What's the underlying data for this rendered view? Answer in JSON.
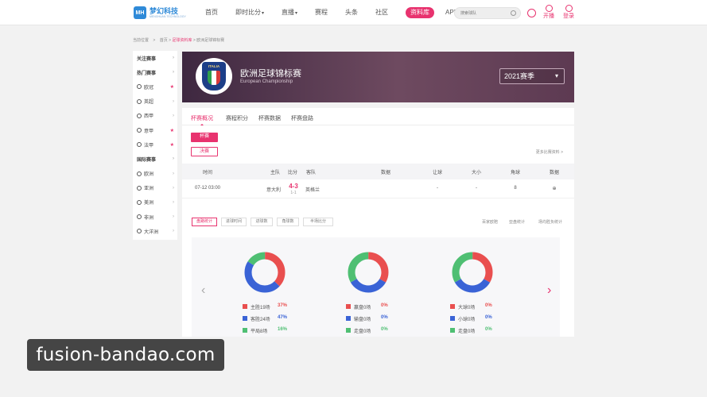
{
  "header": {
    "logo_mark": "MH",
    "logo_name": "梦幻科技",
    "logo_sub": "MENGHUAN TECHNOLOGY",
    "nav": [
      "首页",
      "即时比分",
      "直播",
      "赛程",
      "头条",
      "社区",
      "资料库",
      "APP下载"
    ],
    "search_placeholder": "搜索球队",
    "open_label": "开播",
    "login_label": "登录"
  },
  "breadcrumb": {
    "prefix": "当前位置",
    "home": "首页",
    "db": "足球资料库",
    "current": "欧洲足球锦标赛"
  },
  "sidebar": [
    {
      "label": "关注赛事",
      "type": "header"
    },
    {
      "label": "热门赛事",
      "type": "header"
    },
    {
      "label": "欧冠",
      "type": "fav",
      "icon": "ball-icon"
    },
    {
      "label": "英超",
      "type": "plain",
      "icon": "lion-icon"
    },
    {
      "label": "西甲",
      "type": "plain",
      "icon": "a-icon"
    },
    {
      "label": "意甲",
      "type": "fav",
      "icon": "ball-icon"
    },
    {
      "label": "法甲",
      "type": "fav",
      "icon": "ball-icon"
    },
    {
      "label": "国际赛事",
      "type": "header"
    },
    {
      "label": "欧洲",
      "type": "region",
      "icon": "globe-icon"
    },
    {
      "label": "亚洲",
      "type": "region",
      "icon": "globe-icon"
    },
    {
      "label": "美洲",
      "type": "region",
      "icon": "globe-icon"
    },
    {
      "label": "非洲",
      "type": "region",
      "icon": "globe-icon"
    },
    {
      "label": "大洋洲",
      "type": "region",
      "icon": "globe-icon"
    }
  ],
  "banner": {
    "badge_text": "ITALIA",
    "title": "欧洲足球锦标赛",
    "subtitle": "European Championship",
    "season": "2021赛季"
  },
  "tabs": [
    "杯赛概况",
    "赛程积分",
    "杯赛数据",
    "杯赛盘路"
  ],
  "stage_buttons": [
    "杯赛",
    "决赛"
  ],
  "more_link": "更多比赛资料 >",
  "table": {
    "headers": [
      "时间",
      "主队",
      "比分",
      "客队",
      "数据",
      "让球",
      "大小",
      "角球",
      "数据"
    ],
    "row": {
      "time": "07-12 03:00",
      "home": "意大利",
      "score": "4-3",
      "half": "1-1",
      "away": "英格兰",
      "handicap": "-",
      "ou": "-",
      "corners": "8",
      "data": "⊕"
    }
  },
  "filters": [
    "盘路统计",
    "进球时间",
    "进球数",
    "角球数",
    "半场比分"
  ],
  "filters_right": [
    "百家欧赔",
    "亚盘统计",
    "场均胜负统计"
  ],
  "donuts": [
    {
      "segments": [
        {
          "label": "主胜19场",
          "value": "37%",
          "pct": 37,
          "color": "#e94f4f"
        },
        {
          "label": "客胜24场",
          "value": "47%",
          "pct": 47,
          "color": "#3a63d6"
        },
        {
          "label": "平局8场",
          "value": "16%",
          "pct": 16,
          "color": "#4fbf73"
        }
      ]
    },
    {
      "segments": [
        {
          "label": "赢盘0场",
          "value": "0%",
          "pct": 33.34,
          "color": "#e94f4f"
        },
        {
          "label": "输盘0场",
          "value": "0%",
          "pct": 33.33,
          "color": "#3a63d6"
        },
        {
          "label": "走盘0场",
          "value": "0%",
          "pct": 33.33,
          "color": "#4fbf73"
        }
      ]
    },
    {
      "segments": [
        {
          "label": "大球0场",
          "value": "0%",
          "pct": 33.34,
          "color": "#e94f4f"
        },
        {
          "label": "小球0场",
          "value": "0%",
          "pct": 33.33,
          "color": "#3a63d6"
        },
        {
          "label": "走盘0场",
          "value": "0%",
          "pct": 33.33,
          "color": "#4fbf73"
        }
      ]
    }
  ],
  "watermark": "fusion-bandao.com"
}
